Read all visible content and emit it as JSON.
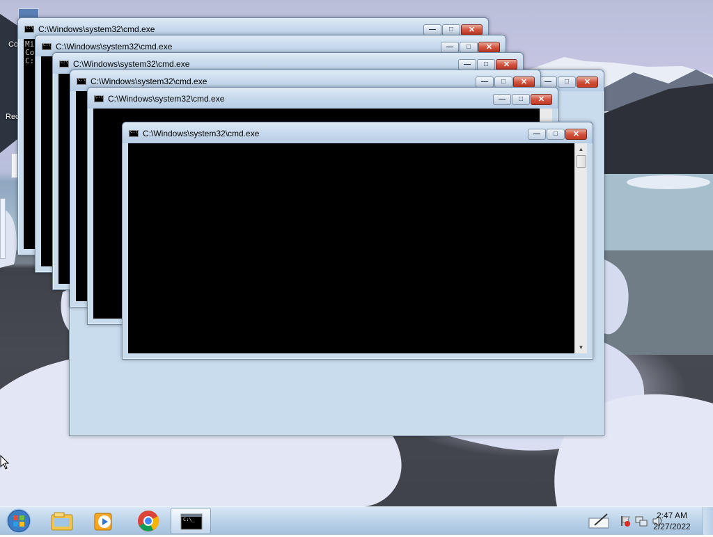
{
  "desktop": {
    "icon_labels": [
      "Co",
      "Rec"
    ]
  },
  "windows": [
    {
      "title": "C:\\Windows\\system32\\cmd.exe",
      "console_lines": [
        "Mi",
        "Co",
        "",
        "C:\\Us"
      ]
    },
    {
      "title": "C:\\Windows\\system32\\cmd.exe"
    },
    {
      "title": "C:\\Windows\\system32\\cmd.exe"
    },
    {
      "title": "C:\\Windows\\system32\\cmd.exe"
    },
    {
      "title": "C:\\Windows\\system32\\cmd.exe"
    },
    {
      "title": "C:\\Windows\\system32\\cmd.exe"
    }
  ],
  "window_controls": {
    "minimize": "—",
    "maximize": "□",
    "close": "✕"
  },
  "taskbar": {
    "start_icon": "windows-logo-icon",
    "pinned": [
      {
        "name": "windows-explorer-icon"
      },
      {
        "name": "media-player-icon"
      },
      {
        "name": "chrome-icon"
      },
      {
        "name": "command-prompt-icon",
        "active": true,
        "label": "C:\\_"
      }
    ],
    "tray_icons": [
      "action-center-flag-icon",
      "network-icon",
      "volume-icon"
    ],
    "clock": {
      "time": "2:47 AM",
      "date": "2/27/2022"
    }
  },
  "colors": {
    "title_bar": "#c5d8ec",
    "close_button": "#d2533e",
    "console_bg": "#000000"
  }
}
